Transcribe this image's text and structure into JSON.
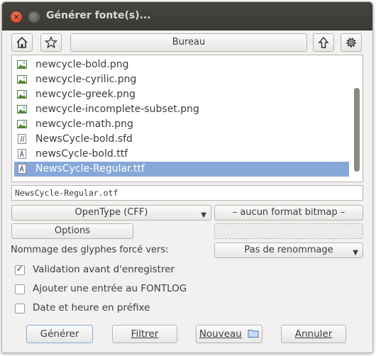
{
  "window": {
    "title": "Générer fonte(s)..."
  },
  "toolbar": {
    "home_icon": "home-icon",
    "bookmark_icon": "star-icon",
    "path_label": "Bureau",
    "up_icon": "up-arrow-icon",
    "settings_icon": "gear-icon"
  },
  "files": [
    {
      "name": "newcycle-bold.png",
      "icon": "image-icon"
    },
    {
      "name": "newcycle-cyrilic.png",
      "icon": "image-icon"
    },
    {
      "name": "newcycle-greek.png",
      "icon": "image-icon"
    },
    {
      "name": "newcycle-incomplete-subset.png",
      "icon": "image-icon"
    },
    {
      "name": "newcycle-math.png",
      "icon": "image-icon"
    },
    {
      "name": "NewsCycle-bold.sfd",
      "icon": "sfd-file-icon"
    },
    {
      "name": "newsCycle-bold.ttf",
      "icon": "font-file-icon"
    },
    {
      "name": "NewsCycle-Regular.ttf",
      "icon": "font-file-icon",
      "selected": true
    }
  ],
  "filename_value": "NewsCycle-Regular.otf",
  "format": {
    "outline": "OpenType (CFF)",
    "bitmap": "– aucun format bitmap –"
  },
  "options_button": "Options",
  "glyph_naming": {
    "label": "Nommage des glyphes forcé vers:",
    "value": "Pas de renommage"
  },
  "checkboxes": [
    {
      "label": "Validation avant d'enregistrer",
      "checked": true
    },
    {
      "label": "Ajouter une entrée au FONTLOG",
      "checked": false
    },
    {
      "label": "Date et heure en préfixe",
      "checked": false
    }
  ],
  "buttons": {
    "generate": "Générer",
    "filter": "Filtrer",
    "new": "Nouveau",
    "cancel": "Annuler"
  },
  "colors": {
    "selection": "#86a8d8",
    "titlebar": "#3c3b37",
    "close": "#e0482b"
  }
}
